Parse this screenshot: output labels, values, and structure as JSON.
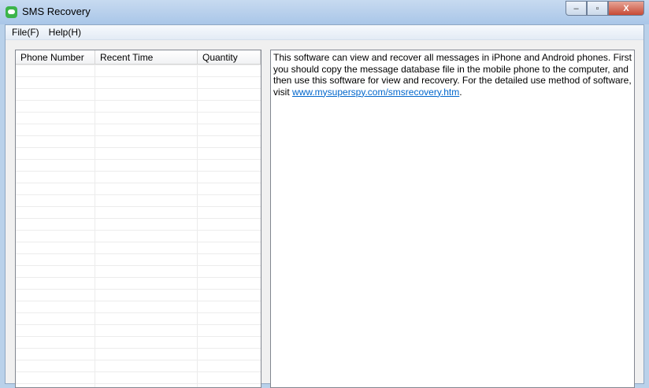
{
  "window": {
    "title": "SMS Recovery",
    "minimize": "‒",
    "maximize": "▫",
    "close": "X"
  },
  "menu": [
    "File(F)",
    "Help(H)"
  ],
  "list": {
    "columns": [
      "Phone Number",
      "Recent Time",
      "Quantity"
    ],
    "rows": []
  },
  "info": {
    "text_before": "This software can view and recover all messages in iPhone and Android phones. First you should copy the message database file in the mobile phone to the computer, and then use this software for view and recovery. For the detailed use method of software, visit ",
    "link": "www.mysuperspy.com/smsrecovery.htm",
    "text_after": "."
  }
}
